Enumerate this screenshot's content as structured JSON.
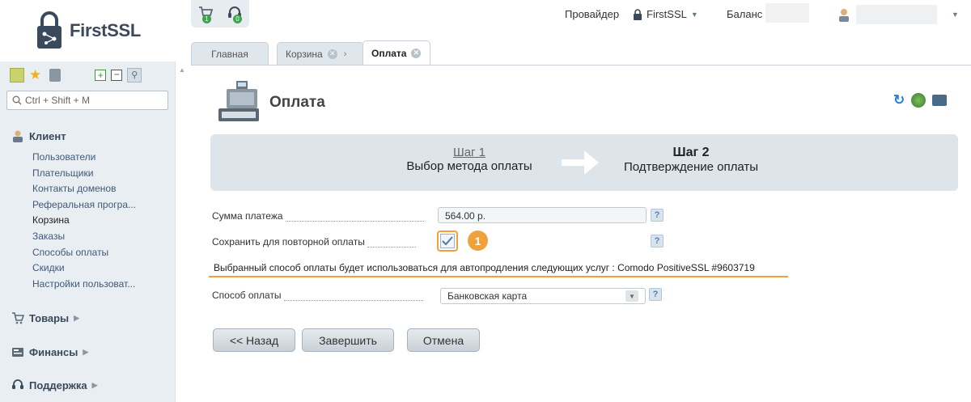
{
  "brand": {
    "logo_text": "FirstSSL"
  },
  "header": {
    "cart_badge": "1",
    "support_badge": "0",
    "provider_label": "Провайдер",
    "provider_value": "FirstSSL",
    "balance_label": "Баланс"
  },
  "sidebar": {
    "search_placeholder": "Ctrl + Shift + M",
    "client_title": "Клиент",
    "client_items": [
      "Пользователи",
      "Плательщики",
      "Контакты доменов",
      "Реферальная програ...",
      "Корзина",
      "Заказы",
      "Способы оплаты",
      "Скидки",
      "Настройки пользоват..."
    ],
    "goods_title": "Товары",
    "finance_title": "Финансы",
    "support_title": "Поддержка"
  },
  "tabs": [
    {
      "label": "Главная"
    },
    {
      "label": "Корзина"
    },
    {
      "label": "Оплата"
    }
  ],
  "page": {
    "title": "Оплата",
    "step1_num": "Шаг 1",
    "step1_label": "Выбор метода оплаты",
    "step2_num": "Шаг 2",
    "step2_label": "Подтверждение оплаты"
  },
  "form": {
    "amount_label": "Сумма платежа",
    "amount_value": "564.00 р.",
    "save_label": "Сохранить для повторной оплаты",
    "save_checked": true,
    "marker": "1",
    "info_text": "Выбранный способ оплаты будет использоваться для автопродления следующих услуг : Comodo PositiveSSL #9603719",
    "method_label": "Способ оплаты",
    "method_value": "Банковская карта",
    "help": "?"
  },
  "buttons": {
    "back": "<< Назад",
    "finish": "Завершить",
    "cancel": "Отмена"
  },
  "colors": {
    "accent": "#f0a23a",
    "sidebar_bg": "#e9eef2",
    "link": "#3f5a78"
  }
}
